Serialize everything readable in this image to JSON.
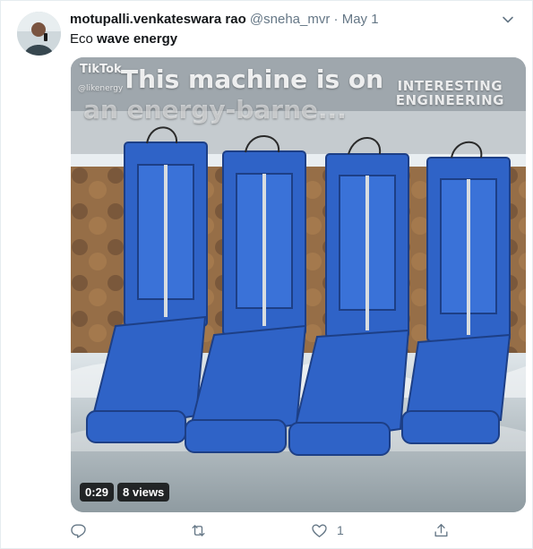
{
  "tweet": {
    "author_name": "motupalli.venkateswara rao",
    "handle": "@sneha_mvr",
    "separator": "·",
    "date": "May 1",
    "text_plain": "Eco",
    "text_bold": "wave energy"
  },
  "media": {
    "caption_line1": "This machine is on",
    "caption_line2": "an energy-barne...",
    "tiktok_logo": "TikTok",
    "tiktok_user": "@likenergy",
    "brand_line1": "INTERESTING",
    "brand_line2": "ENGINEERING",
    "duration": "0:29",
    "views": "8 views"
  },
  "actions": {
    "reply_count": "",
    "retweet_count": "",
    "like_count": "1",
    "share_count": ""
  },
  "icons": {
    "chevron": "chevron-down-icon",
    "reply": "reply-icon",
    "retweet": "retweet-icon",
    "like": "heart-icon",
    "share": "share-icon"
  },
  "colors": {
    "text": "#14171a",
    "secondary": "#657786",
    "border": "#e6ecf0",
    "machine_blue": "#2f63c7"
  }
}
